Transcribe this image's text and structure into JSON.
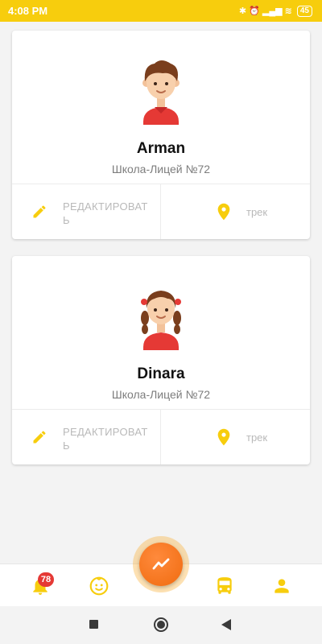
{
  "status_bar": {
    "time": "4:08 PM",
    "indicators": "✱ ⏰ ▂▄▆ ≋",
    "battery": "45"
  },
  "children": [
    {
      "name": "Arman",
      "school": "Школа-Лицей №72",
      "avatar": "boy-avatar-icon",
      "edit_label": "РЕДАКТИРОВАТЬ",
      "track_label": "трек"
    },
    {
      "name": "Dinara",
      "school": "Школа-Лицей №72",
      "avatar": "girl-avatar-icon",
      "edit_label": "РЕДАКТИРОВАТЬ",
      "track_label": "трек"
    }
  ],
  "bottom_nav": {
    "notifications_badge": "78",
    "items": [
      "bell-icon",
      "baby-face-icon",
      "trend-icon",
      "bus-icon",
      "user-icon"
    ]
  },
  "colors": {
    "accent": "#f7cd0d",
    "fab": "#f06b0f",
    "badge": "#e53935"
  }
}
